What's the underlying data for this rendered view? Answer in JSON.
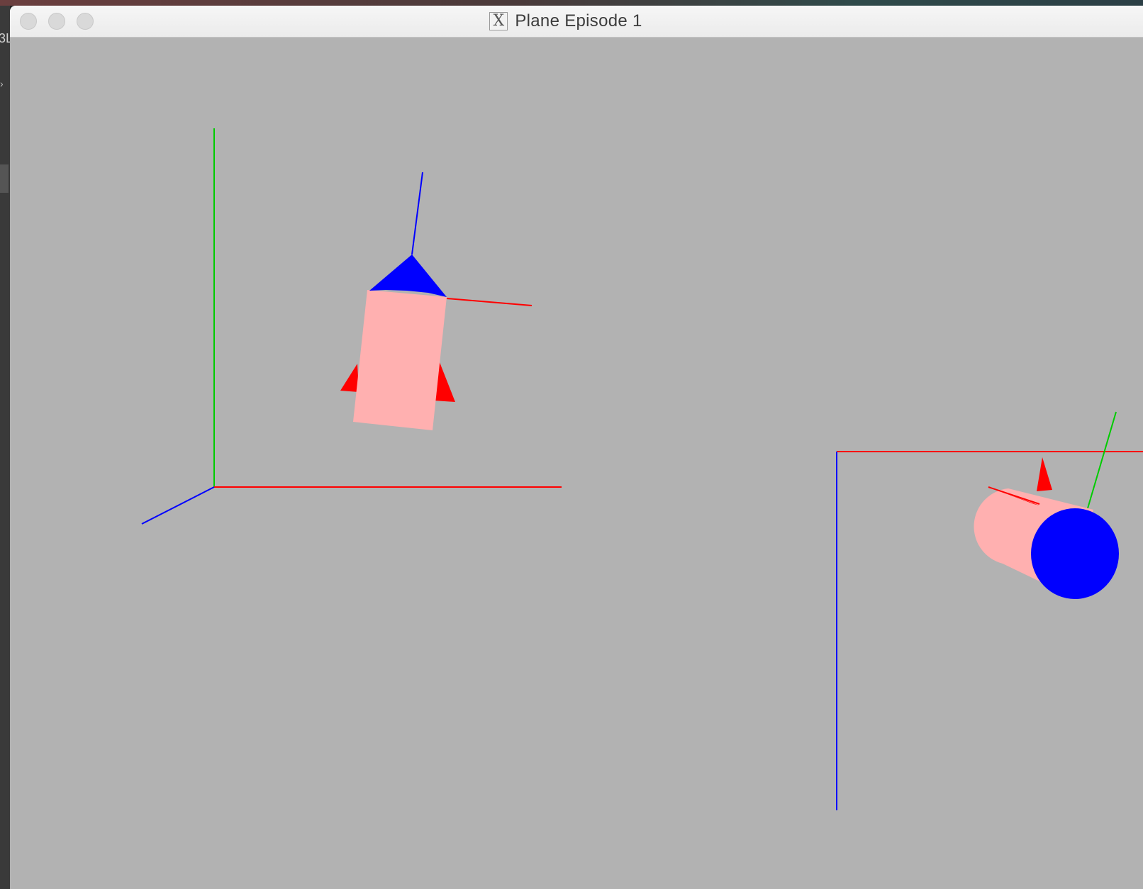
{
  "desktop": {
    "edge_text": "3L",
    "edge_arrow": "›"
  },
  "window": {
    "title": "Plane Episode 1",
    "app_icon": "x11-icon",
    "buttons": [
      "close-button",
      "minimize-button",
      "zoom-button"
    ]
  },
  "scene": {
    "background": "#b2b2b2",
    "colors": {
      "x_axis": "#ff0000",
      "y_axis": "#00cc00",
      "z_axis": "#0000ff",
      "rocket_body": "#ffb0b0",
      "rocket_nose": "#0000ff",
      "rocket_fin": "#ff0000"
    },
    "objects": [
      "world-axes",
      "rocket",
      "second-axes",
      "second-rocket"
    ]
  }
}
